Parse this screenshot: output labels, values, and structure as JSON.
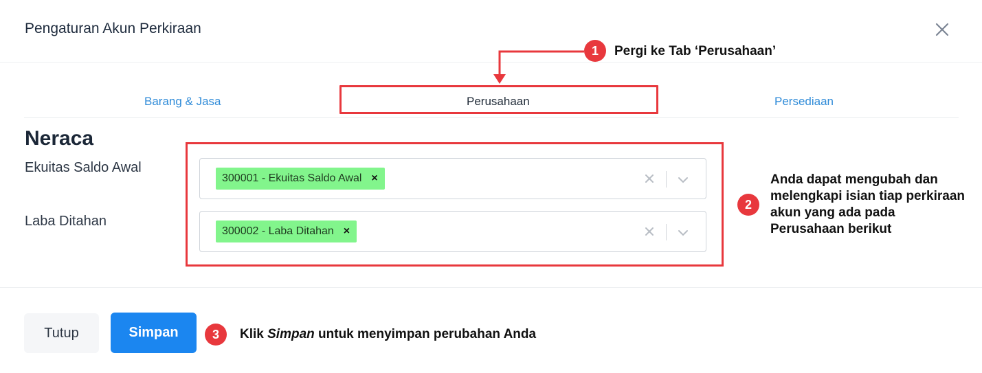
{
  "modal": {
    "title": "Pengaturan Akun Perkiraan"
  },
  "tabs": [
    {
      "label": "Barang & Jasa"
    },
    {
      "label": "Perusahaan"
    },
    {
      "label": "Persediaan"
    }
  ],
  "section": {
    "title": "Neraca",
    "fields": [
      {
        "label": "Ekuitas Saldo Awal",
        "tag": "300001 - Ekuitas Saldo Awal"
      },
      {
        "label": "Laba Ditahan",
        "tag": "300002 - Laba Ditahan"
      }
    ]
  },
  "footer": {
    "close_label": "Tutup",
    "save_label": "Simpan"
  },
  "annotations": [
    {
      "number": "1",
      "text": "Pergi ke Tab ‘Perusahaan’"
    },
    {
      "number": "2",
      "text": "Anda dapat mengubah dan melengkapi isian tiap perkiraan akun yang ada pada Perusahaan berikut"
    },
    {
      "number": "3",
      "text_em": "Simpan",
      "text_pre": "Klik ",
      "text_post": " untuk menyimpan perubahan Anda"
    }
  ],
  "colors": {
    "accent_blue": "#1b86f0",
    "tab_link": "#2f8bd8",
    "tag_green": "#82f58c",
    "highlight_red": "#e8383d"
  }
}
